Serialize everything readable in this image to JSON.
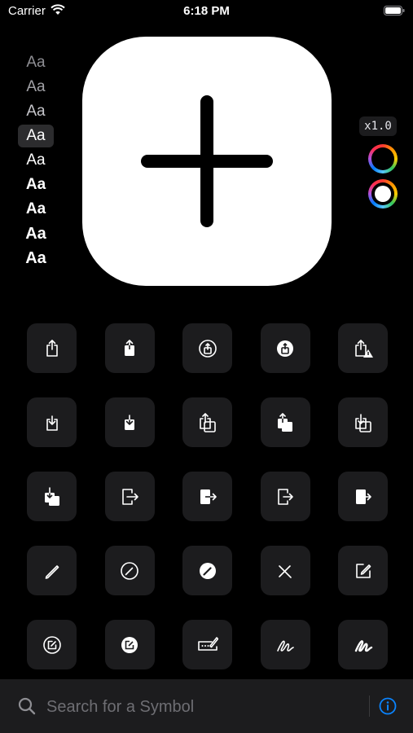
{
  "status_bar": {
    "carrier": "Carrier",
    "time": "6:18 PM"
  },
  "weights": [
    {
      "label": "Aa",
      "weight": 100,
      "color": "#8e8e93"
    },
    {
      "label": "Aa",
      "weight": 200,
      "color": "#a1a1a6"
    },
    {
      "label": "Aa",
      "weight": 300,
      "color": "#c7c7cc"
    },
    {
      "label": "Aa",
      "weight": 400,
      "color": "#ffffff",
      "selected": true
    },
    {
      "label": "Aa",
      "weight": 500,
      "color": "#ffffff"
    },
    {
      "label": "Aa",
      "weight": 600,
      "color": "#ffffff"
    },
    {
      "label": "Aa",
      "weight": 700,
      "color": "#ffffff"
    },
    {
      "label": "Aa",
      "weight": 800,
      "color": "#ffffff"
    },
    {
      "label": "Aa",
      "weight": 900,
      "color": "#ffffff"
    }
  ],
  "preview": {
    "symbol": "plus-icon"
  },
  "scale": {
    "label": "x1.0"
  },
  "colors": {
    "accent": "#0a84ff",
    "cell_bg": "#1c1c1e"
  },
  "symbols": [
    "square-and-arrow-up-icon",
    "square-and-arrow-up-fill-icon",
    "square-and-arrow-up-circle-icon",
    "square-and-arrow-up-circle-fill-icon",
    "square-and-arrow-up-trianglebadge-exclamationmark-icon",
    "square-and-arrow-down-icon",
    "square-and-arrow-down-fill-icon",
    "square-and-arrow-up-on-square-icon",
    "square-and-arrow-up-on-square-fill-icon",
    "square-and-arrow-down-on-square-icon",
    "square-and-arrow-down-on-square-fill-icon",
    "rectangle-portrait-and-arrow-right-icon",
    "rectangle-portrait-and-arrow-right-fill-icon",
    "rectangle-portrait-and-arrow-forward-icon",
    "rectangle-portrait-and-arrow-forward-fill-icon",
    "pencil-icon",
    "pencil-circle-icon",
    "pencil-circle-fill-icon",
    "pencil-slash-icon",
    "square-and-pencil-icon",
    "square-and-pencil-circle-icon",
    "square-and-pencil-circle-fill-icon",
    "rectangle-and-pencil-and-ellipsis-icon",
    "scribble-icon",
    "scribble-variable-icon"
  ],
  "search": {
    "placeholder": "Search for a Symbol"
  }
}
